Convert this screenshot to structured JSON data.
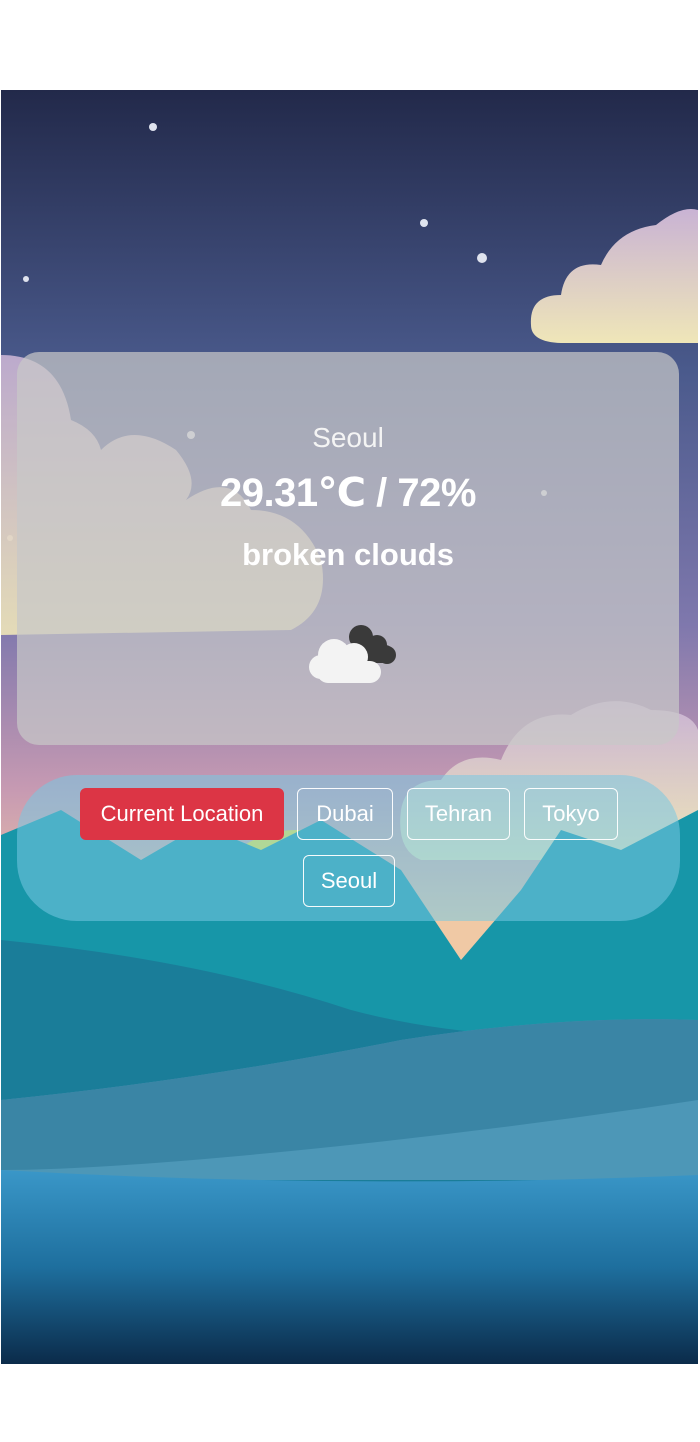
{
  "weather": {
    "city": "Seoul",
    "temperature_humidity": "29.31℃ / 72%",
    "description": "broken clouds",
    "icon": "broken-clouds-icon"
  },
  "buttons": [
    {
      "label": "Current Location",
      "active": true
    },
    {
      "label": "Dubai",
      "active": false
    },
    {
      "label": "Tehran",
      "active": false
    },
    {
      "label": "Tokyo",
      "active": false
    },
    {
      "label": "Seoul",
      "active": false
    }
  ],
  "colors": {
    "active_button": "#dc3545",
    "sky_top": "#22294a",
    "sea": "#1e7fb0"
  }
}
